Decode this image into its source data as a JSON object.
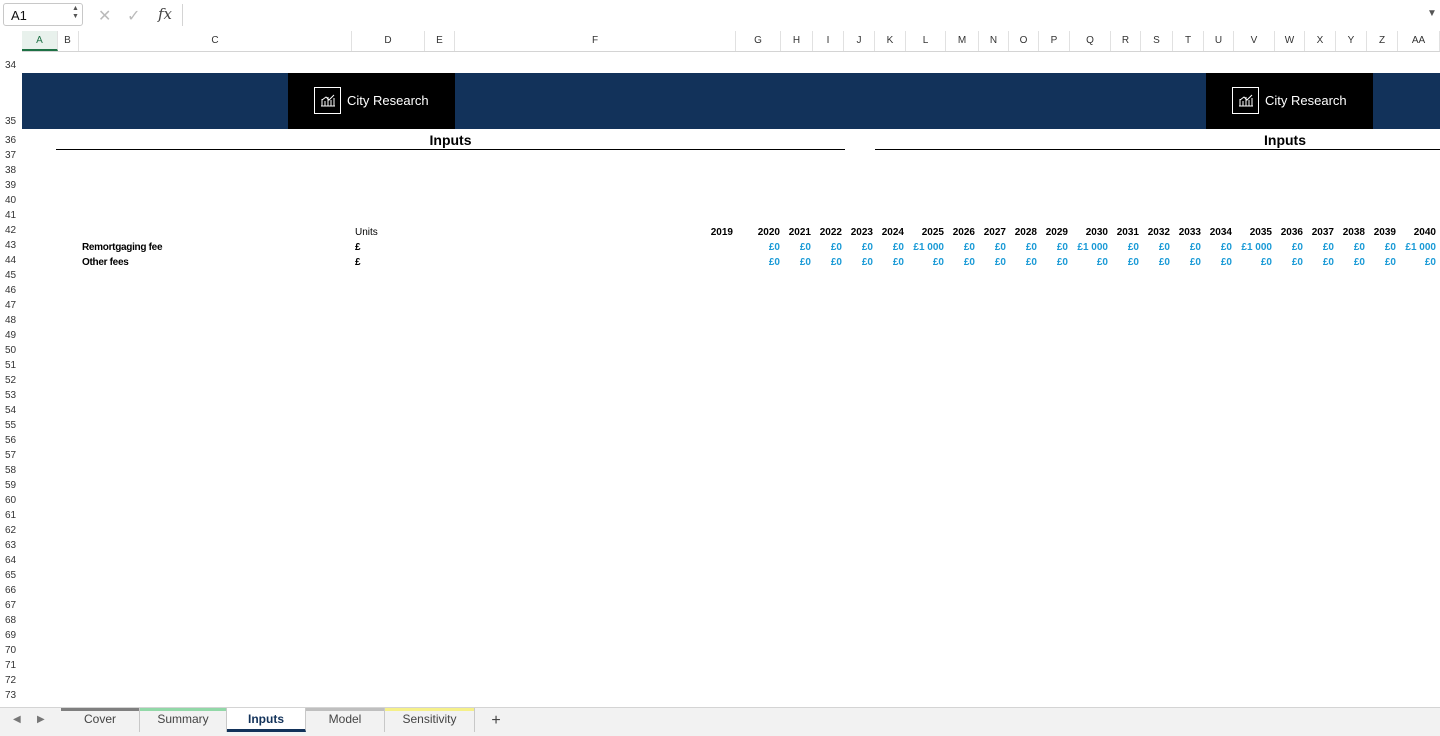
{
  "namebox": "A1",
  "icons": {
    "cancel": "close-icon",
    "confirm": "check-icon",
    "function": "fx-icon"
  },
  "fx_label": "fx",
  "columns": [
    "A",
    "B",
    "C",
    "D",
    "E",
    "F",
    "G",
    "H",
    "I",
    "J",
    "K",
    "L",
    "M",
    "N",
    "O",
    "P",
    "Q",
    "R",
    "S",
    "T",
    "U",
    "V",
    "W",
    "X",
    "Y",
    "Z",
    "AA"
  ],
  "selected_column": "A",
  "rows": [
    "34",
    "35",
    "36",
    "37",
    "38",
    "39",
    "40",
    "41",
    "42",
    "43",
    "44",
    "45",
    "46",
    "47",
    "48",
    "49",
    "50",
    "51",
    "52",
    "53",
    "54",
    "55",
    "56",
    "57",
    "58",
    "59",
    "60",
    "61",
    "62",
    "63",
    "64",
    "65",
    "66",
    "67",
    "68",
    "69",
    "70",
    "71",
    "72",
    "73"
  ],
  "brand": "City Research",
  "section_title": "Inputs",
  "units_header": "Units",
  "years": [
    "2019",
    "2020",
    "2021",
    "2022",
    "2023",
    "2024",
    "2025",
    "2026",
    "2027",
    "2028",
    "2029",
    "2030",
    "2031",
    "2032",
    "2033",
    "2034",
    "2035",
    "2036",
    "2037",
    "2038",
    "2039",
    "2040"
  ],
  "table_rows": [
    {
      "label": "Remortgaging fee",
      "unit": "£",
      "values": [
        "£0",
        "£0",
        "£0",
        "£0",
        "£0",
        "£1 000",
        "£0",
        "£0",
        "£0",
        "£0",
        "£1 000",
        "£0",
        "£0",
        "£0",
        "£0",
        "£1 000",
        "£0",
        "£0",
        "£0",
        "£0",
        "£1 000"
      ]
    },
    {
      "label": "Other fees",
      "unit": "£",
      "values": [
        "£0",
        "£0",
        "£0",
        "£0",
        "£0",
        "£0",
        "£0",
        "£0",
        "£0",
        "£0",
        "£0",
        "£0",
        "£0",
        "£0",
        "£0",
        "£0",
        "£0",
        "£0",
        "£0",
        "£0",
        "£0"
      ]
    }
  ],
  "sheets": [
    {
      "name": "Cover",
      "color": "#7f7f7f",
      "active": false
    },
    {
      "name": "Summary",
      "color": "#92d8a8",
      "active": false
    },
    {
      "name": "Inputs",
      "color": "#12325a",
      "active": true
    },
    {
      "name": "Model",
      "color": "#bfbfbf",
      "active": false
    },
    {
      "name": "Sensitivity",
      "color": "#f5f08a",
      "active": false
    }
  ],
  "add_sheet": "+"
}
